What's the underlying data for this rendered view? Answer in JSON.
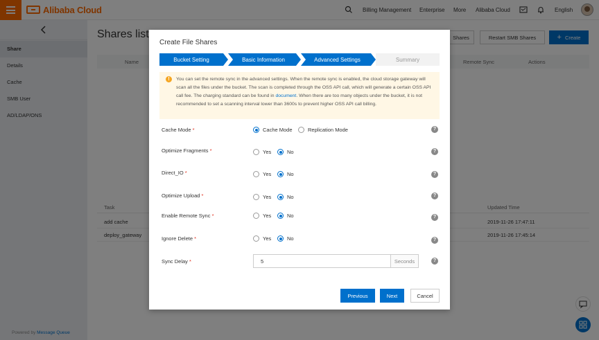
{
  "topbar": {
    "brand": "Alibaba Cloud",
    "nav": [
      "Billing Management",
      "Enterprise",
      "More",
      "Alibaba Cloud"
    ],
    "language": "English"
  },
  "sidebar": {
    "items": [
      {
        "label": "Share",
        "active": true
      },
      {
        "label": "Details",
        "active": false
      },
      {
        "label": "Cache",
        "active": false
      },
      {
        "label": "SMB User",
        "active": false
      },
      {
        "label": "AD/LDAP/ONS",
        "active": false
      }
    ],
    "powered_prefix": "Powered by ",
    "powered_link": "Message Queue"
  },
  "main": {
    "title": "Shares list",
    "buttons": {
      "shares": "Shares",
      "restart": "Restart SMB Shares",
      "create": "Create"
    },
    "table_headers": {
      "name": "Name",
      "remote_sync": "Remote Sync",
      "actions": "Actions"
    },
    "tasks": {
      "headers": {
        "task": "Task",
        "updated": "Updated Time"
      },
      "rows": [
        {
          "task": "add cache",
          "updated": "2019-11-26 17:47:11"
        },
        {
          "task": "deploy_gateway",
          "updated": "2019-11-26 17:45:14"
        }
      ]
    }
  },
  "modal": {
    "title": "Create File Shares",
    "steps": [
      {
        "label": "Bucket Setting",
        "state": "done"
      },
      {
        "label": "Basic Information",
        "state": "done"
      },
      {
        "label": "Advanced Settings",
        "state": "current"
      },
      {
        "label": "Summary",
        "state": "todo"
      }
    ],
    "notice": {
      "text_before": "You can set the remote sync in the advanced settings. When the remote sync is enabled, the cloud storage gateway will scan all the files under the bucket. The scan is completed through the OSS API call, which will generate a certain OSS API call fee. The charging standard can be found in ",
      "link": "document",
      "text_after": ". When there are too many objects under the bucket, it is not recommended to set a scanning interval lower than 3600s to prevent higher OSS API call billing."
    },
    "fields": {
      "cache_mode": {
        "label": "Cache Mode",
        "options": [
          "Cache Mode",
          "Replication Mode"
        ],
        "selected": "Cache Mode"
      },
      "optimize_fragments": {
        "label": "Optimize Fragments",
        "options": [
          "Yes",
          "No"
        ],
        "selected": "No"
      },
      "direct_io": {
        "label": "Direct_IO",
        "options": [
          "Yes",
          "No"
        ],
        "selected": "No"
      },
      "optimize_upload": {
        "label": "Optimize Upload",
        "options": [
          "Yes",
          "No"
        ],
        "selected": "No"
      },
      "enable_remote_sync": {
        "label": "Enable Remote Sync",
        "options": [
          "Yes",
          "No"
        ],
        "selected": "No"
      },
      "ignore_delete": {
        "label": "Ignore Delete",
        "options": [
          "Yes",
          "No"
        ],
        "selected": "No"
      },
      "sync_delay": {
        "label": "Sync Delay",
        "value": "5",
        "unit": "Seconds"
      }
    },
    "required_mark": "*",
    "help_glyph": "?",
    "buttons": {
      "previous": "Previous",
      "next": "Next",
      "cancel": "Cancel"
    }
  },
  "colors": {
    "brand_orange": "#ff6a00",
    "primary_blue": "#0070cc",
    "notice_bg": "#fff7e5",
    "required_red": "#e0301e"
  }
}
